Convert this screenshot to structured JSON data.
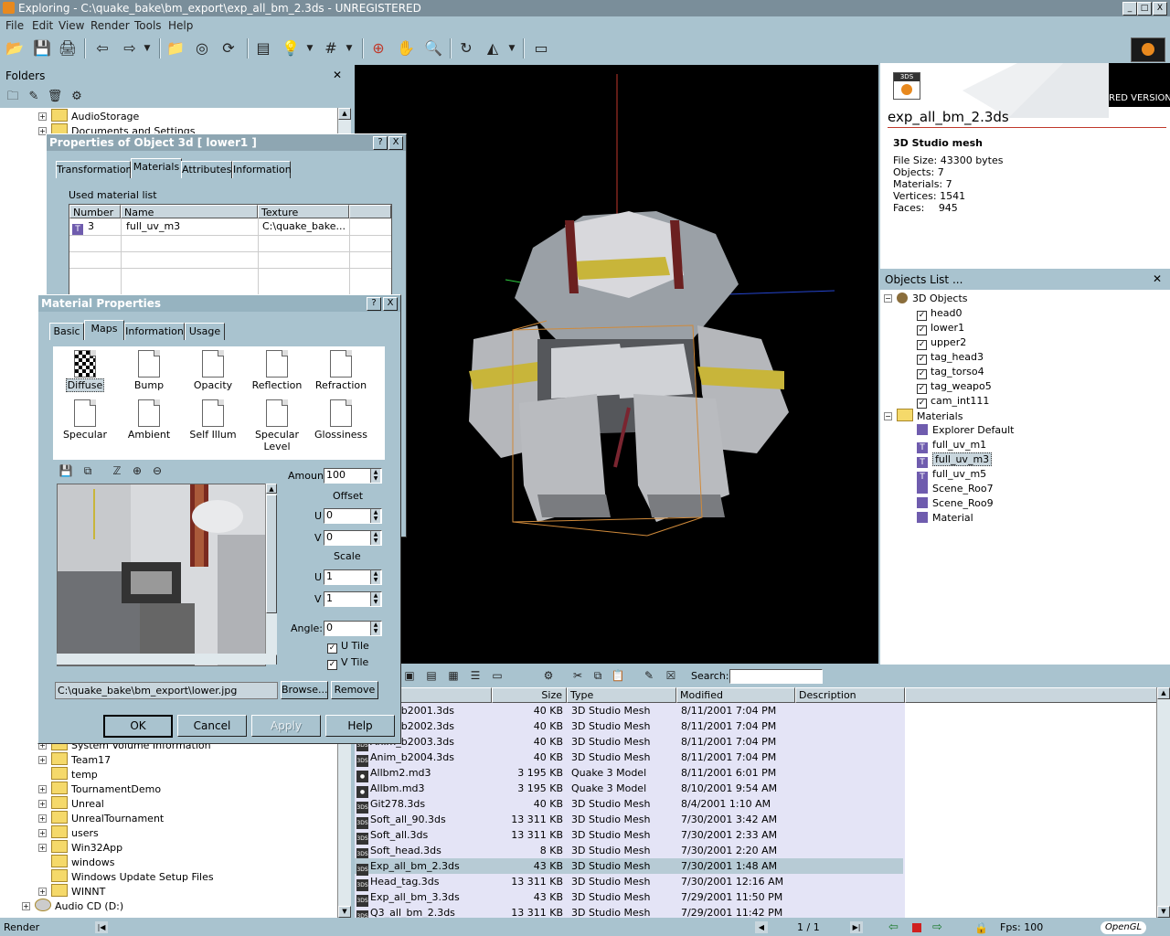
{
  "window": {
    "title": "Exploring - C:\\quake_bake\\bm_export\\exp_all_bm_2.3ds - UNREGISTERED",
    "controls": [
      "_",
      "□",
      "X"
    ]
  },
  "menu": [
    "File",
    "Edit",
    "View",
    "Render",
    "Tools",
    "Help"
  ],
  "folders_panel": {
    "title": "Folders",
    "close": "✕",
    "top_items": [
      "AudioStorage",
      "Documents and Settings"
    ],
    "bottom_items": [
      "System Volume Information",
      "Team17",
      "temp",
      "TournamentDemo",
      "Unreal",
      "UnrealTournament",
      "users",
      "Win32App",
      "windows",
      "Windows Update Setup Files",
      "WINNT",
      "Audio CD (D:)"
    ]
  },
  "props_dialog": {
    "title": "Properties of Object 3d [ lower1 ]",
    "help": "?",
    "close": "X",
    "tabs": [
      "Transformation",
      "Materials",
      "Attributes",
      "Information"
    ],
    "list_label": "Used material list",
    "columns": [
      "Number",
      "Name",
      "Texture"
    ],
    "rows": [
      {
        "number": "3",
        "name": "full_uv_m3",
        "texture": "C:\\quake_bake..."
      }
    ]
  },
  "material_dialog": {
    "title": "Material Properties",
    "help": "?",
    "close": "X",
    "tabs": [
      "Basic",
      "Maps",
      "Information",
      "Usage"
    ],
    "maps": [
      "Diffuse",
      "Bump",
      "Opacity",
      "Reflection",
      "Refraction",
      "Specular",
      "Ambient",
      "Self Illum",
      "Specular Level",
      "Glossiness"
    ],
    "amount_label": "Amount",
    "amount": "100",
    "offset_label": "Offset",
    "u_label": "U",
    "v_label": "V",
    "offset_u": "0",
    "offset_v": "0",
    "scale_label": "Scale",
    "scale_u": "1",
    "scale_v": "1",
    "angle_label": "Angle:",
    "angle": "0",
    "utile": "U Tile",
    "vtile": "V Tile",
    "path": "C:\\quake_bake\\bm_export\\lower.jpg",
    "browse": "Browse...",
    "remove": "Remove",
    "ok": "OK",
    "cancel": "Cancel",
    "apply": "Apply",
    "help_btn": "Help"
  },
  "info_panel": {
    "badge": "3DS",
    "watermark": "RED VERSION",
    "filename": "exp_all_bm_2.3ds",
    "type": "3D Studio mesh",
    "stats": [
      {
        "label": "File Size:",
        "value": "43300 bytes"
      },
      {
        "label": "Objects:",
        "value": "7"
      },
      {
        "label": "Materials:",
        "value": "7"
      },
      {
        "label": "Vertices:",
        "value": "1541"
      },
      {
        "label": "Faces:",
        "value": "945"
      }
    ]
  },
  "objects_panel": {
    "title": "Objects List  ...",
    "close": "✕",
    "objects_root": "3D Objects",
    "objects": [
      "head0",
      "lower1",
      "upper2",
      "tag_head3",
      "tag_torso4",
      "tag_weapo5",
      "cam_int111"
    ],
    "materials_root": "Materials",
    "materials": [
      "Explorer Default",
      "full_uv_m1",
      "full_uv_m3",
      "full_uv_m5",
      "Scene_Roo7",
      "Scene_Roo9",
      "Material"
    ],
    "selected_material": "full_uv_m3"
  },
  "filelist": {
    "search_label": "Search:",
    "columns": [
      "Size",
      "Type",
      "Modified",
      "Description"
    ],
    "rows": [
      {
        "name": "Anim_b2001.3ds",
        "size": "40 KB",
        "type": "3D Studio Mesh",
        "modified": "8/11/2001 7:04 PM",
        "icon": "3ds"
      },
      {
        "name": "Anim_b2002.3ds",
        "size": "40 KB",
        "type": "3D Studio Mesh",
        "modified": "8/11/2001 7:04 PM",
        "icon": "3ds"
      },
      {
        "name": "Anim_b2003.3ds",
        "size": "40 KB",
        "type": "3D Studio Mesh",
        "modified": "8/11/2001 7:04 PM",
        "icon": "3ds"
      },
      {
        "name": "Anim_b2004.3ds",
        "size": "40 KB",
        "type": "3D Studio Mesh",
        "modified": "8/11/2001 7:04 PM",
        "icon": "3ds"
      },
      {
        "name": "Allbm2.md3",
        "size": "3 195 KB",
        "type": "Quake 3 Model",
        "modified": "8/11/2001 6:01 PM",
        "icon": "md3"
      },
      {
        "name": "Allbm.md3",
        "size": "3 195 KB",
        "type": "Quake 3 Model",
        "modified": "8/10/2001 9:54 AM",
        "icon": "md3"
      },
      {
        "name": "Git278.3ds",
        "size": "40 KB",
        "type": "3D Studio Mesh",
        "modified": "8/4/2001 1:10 AM",
        "icon": "3ds"
      },
      {
        "name": "Soft_all_90.3ds",
        "size": "13 311 KB",
        "type": "3D Studio Mesh",
        "modified": "7/30/2001 3:42 AM",
        "icon": "3ds"
      },
      {
        "name": "Soft_all.3ds",
        "size": "13 311 KB",
        "type": "3D Studio Mesh",
        "modified": "7/30/2001 2:33 AM",
        "icon": "3ds"
      },
      {
        "name": "Soft_head.3ds",
        "size": "8 KB",
        "type": "3D Studio Mesh",
        "modified": "7/30/2001 2:20 AM",
        "icon": "3ds"
      },
      {
        "name": "Exp_all_bm_2.3ds",
        "size": "43 KB",
        "type": "3D Studio Mesh",
        "modified": "7/30/2001 1:48 AM",
        "icon": "3ds"
      },
      {
        "name": "Head_tag.3ds",
        "size": "13 311 KB",
        "type": "3D Studio Mesh",
        "modified": "7/30/2001 12:16 AM",
        "icon": "3ds"
      },
      {
        "name": "Exp_all_bm_3.3ds",
        "size": "43 KB",
        "type": "3D Studio Mesh",
        "modified": "7/29/2001 11:50 PM",
        "icon": "3ds"
      },
      {
        "name": "Q3_all_bm_2.3ds",
        "size": "13 311 KB",
        "type": "3D Studio Mesh",
        "modified": "7/29/2001 11:42 PM",
        "icon": "3ds"
      }
    ],
    "selected_index": 10
  },
  "status": {
    "left": "Render",
    "page": "1 / 1",
    "fps": "Fps: 100",
    "renderer": "OpenGL"
  }
}
